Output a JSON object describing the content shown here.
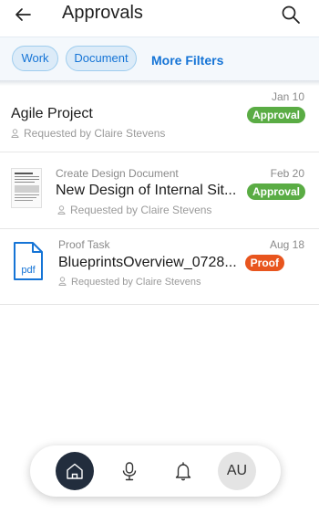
{
  "header": {
    "title": "Approvals",
    "back_icon": "arrow-left-icon",
    "search_icon": "search-icon"
  },
  "filters": {
    "chips": [
      "Work",
      "Document"
    ],
    "more_label": "More Filters"
  },
  "items": [
    {
      "subtitle": "",
      "title": "Agile Project",
      "requested": "Requested by Claire Stevens",
      "date": "Jan 10",
      "badge": "Approval",
      "thumbnail": "none"
    },
    {
      "subtitle": "Create Design Document",
      "title": "New Design of Internal Sit...",
      "requested": "Requested by Claire Stevens",
      "date": "Feb 20",
      "badge": "Approval",
      "thumbnail": "document-thumbnail"
    },
    {
      "subtitle": "Proof Task",
      "title": "BlueprintsOverview_0728...",
      "requested": "Requested by Claire Stevens",
      "date": "Aug 18",
      "badge": "Proof",
      "thumbnail": "pdf-icon",
      "thumbnail_label": "pdf"
    }
  ],
  "nav": {
    "avatar_initials": "AU",
    "icons": [
      "home-icon",
      "microphone-icon",
      "bell-icon"
    ]
  },
  "colors": {
    "accent": "#1574d6",
    "approval": "#5aac44",
    "proof": "#e8551e",
    "nav_active": "#222d3d"
  }
}
